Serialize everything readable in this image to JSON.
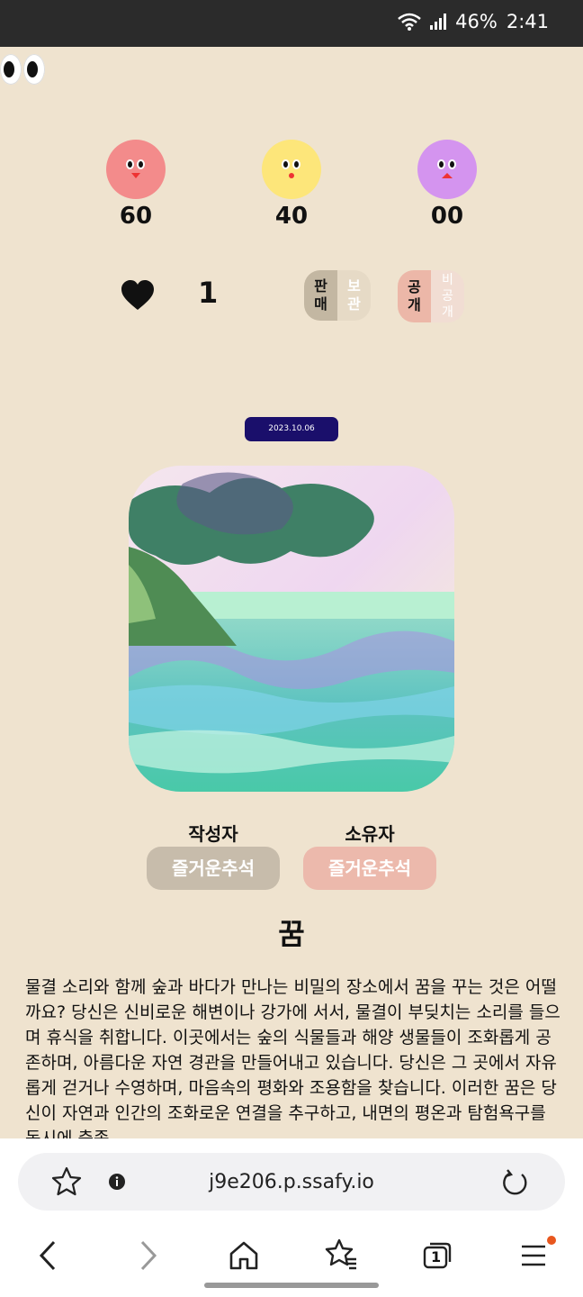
{
  "status_bar": {
    "battery": "46%",
    "time": "2:41"
  },
  "emotions": [
    {
      "name": "red",
      "count": "60",
      "color": "#f38b8b"
    },
    {
      "name": "yellow",
      "count": "40",
      "color": "#fde67a"
    },
    {
      "name": "purple",
      "count": "00",
      "color": "#d494ef"
    }
  ],
  "likes": {
    "count": "1"
  },
  "sale_toggle": {
    "left_top": "판",
    "left_bottom": "매",
    "right_top": "보",
    "right_bottom": "관"
  },
  "public_toggle": {
    "left_top": "공",
    "left_bottom": "개",
    "right_top": "비",
    "right_mid": "공",
    "right_bottom": "개"
  },
  "date": "2023.10.06",
  "author": {
    "label": "작성자",
    "name": "즐거운추석"
  },
  "owner": {
    "label": "소유자",
    "name": "즐거운추석"
  },
  "dream": {
    "title": "꿈",
    "description": "물결 소리와 함께 숲과 바다가 만나는 비밀의 장소에서 꿈을 꾸는 것은 어떨까요? 당신은 신비로운 해변이나 강가에 서서, 물결이 부딪치는 소리를 들으며 휴식을 취합니다. 이곳에서는 숲의 식물들과 해양 생물들이 조화롭게 공존하며, 아름다운 자연 경관을 만들어내고 있습니다. 당신은 그 곳에서 자유롭게 걷거나 수영하며, 마음속의 평화와 조용함을 찾습니다. 이러한 꿈은 당신이 자연과 인간의 조화로운 연결을 추구하고, 내면의 평온과 탐험욕구를 동시에 충족"
  },
  "browser": {
    "url": "j9e206.p.ssafy.io",
    "tabs_count": "1"
  },
  "colors": {
    "background": "#efe3cf",
    "date_badge": "#1a0f6b",
    "author_button": "#c7bcab",
    "owner_button": "#ecb9ac"
  }
}
